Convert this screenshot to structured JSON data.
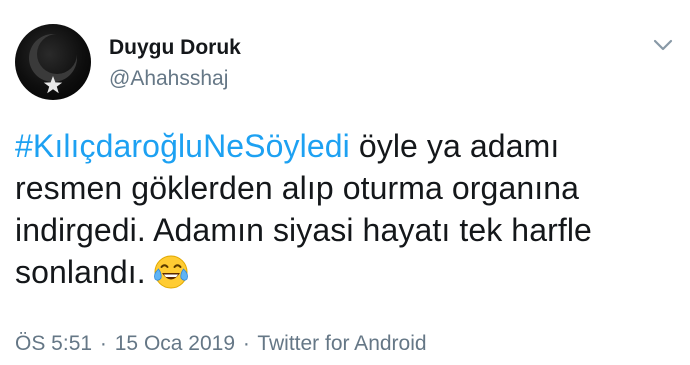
{
  "author": {
    "display_name": "Duygu Doruk",
    "handle": "@Ahahsshaj"
  },
  "tweet": {
    "hashtag": "#KılıçdaroğluNeSöyledi",
    "lines": [
      " öyle ya adamı",
      "resmen göklerden alıp oturma organına",
      "indirgedi. Adamın siyasi hayatı tek harfle",
      "sonlandı."
    ],
    "emoji": "face-with-tears-of-joy"
  },
  "meta": {
    "time": "ÖS 5:51",
    "separator": "·",
    "date": "15 Oca 2019",
    "source": "Twitter for Android"
  },
  "colors": {
    "text": "#14171a",
    "secondary": "#657786",
    "link": "#1da1f2",
    "background": "#ffffff"
  },
  "icons": {
    "menu": "chevron-down-icon",
    "avatar_motif": "crescent-and-star"
  }
}
